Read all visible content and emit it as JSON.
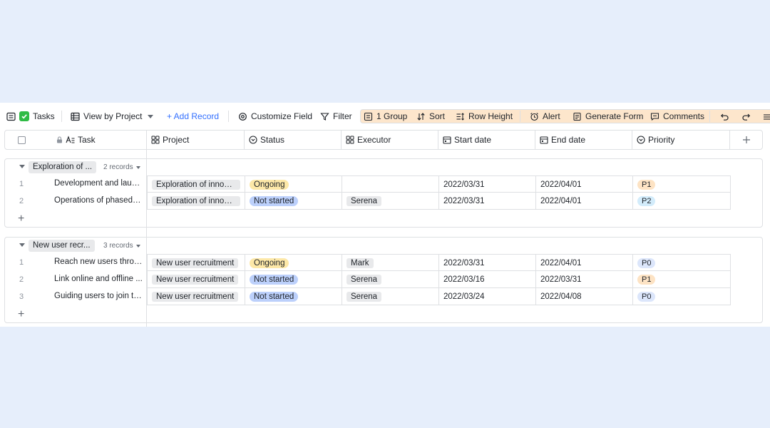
{
  "toolbar": {
    "table_name": "Tasks",
    "view_name": "View by Project",
    "add_record": "+ Add Record",
    "customize_field": "Customize Field",
    "filter": "Filter",
    "group": "1 Group",
    "sort": "Sort",
    "row_height": "Row Height",
    "alert": "Alert",
    "generate_form": "Generate Form",
    "comments": "Comments"
  },
  "columns": {
    "task": "Task",
    "project": "Project",
    "status": "Status",
    "executor": "Executor",
    "start_date": "Start date",
    "end_date": "End date",
    "priority": "Priority"
  },
  "groups": [
    {
      "name": "Exploration of ...",
      "count": "2 records",
      "rows": [
        {
          "num": "1",
          "task": "Development and launc...",
          "project": "Exploration of innova...",
          "status": "Ongoing",
          "executor": "",
          "start": "2022/03/31",
          "end": "2022/04/01",
          "priority": "P1"
        },
        {
          "num": "2",
          "task": "Operations of phased r...",
          "project": "Exploration of innova...",
          "status": "Not started",
          "executor": "Serena",
          "start": "2022/03/31",
          "end": "2022/04/01",
          "priority": "P2"
        }
      ]
    },
    {
      "name": "New user recr...",
      "count": "3 records",
      "rows": [
        {
          "num": "1",
          "task": "Reach new users throu...",
          "project": "New user recruitment",
          "status": "Ongoing",
          "executor": "Mark",
          "start": "2022/03/31",
          "end": "2022/04/01",
          "priority": "P0"
        },
        {
          "num": "2",
          "task": "Link online and offline ...",
          "project": "New user recruitment",
          "status": "Not started",
          "executor": "Serena",
          "start": "2022/03/16",
          "end": "2022/03/31",
          "priority": "P1"
        },
        {
          "num": "3",
          "task": "Guiding users to join th...",
          "project": "New user recruitment",
          "status": "Not started",
          "executor": "Serena",
          "start": "2022/03/24",
          "end": "2022/04/08",
          "priority": "P0"
        }
      ]
    }
  ],
  "colors": {
    "background": "#e6eefb",
    "accent": "#3370ff",
    "status_ongoing": "#fde8a8",
    "status_not_started": "#bcd0fb",
    "priority_p0": "#dce6fb",
    "priority_p1": "#fde3c4",
    "priority_p2": "#d3ecfb",
    "group_button": "#fde6cc"
  }
}
